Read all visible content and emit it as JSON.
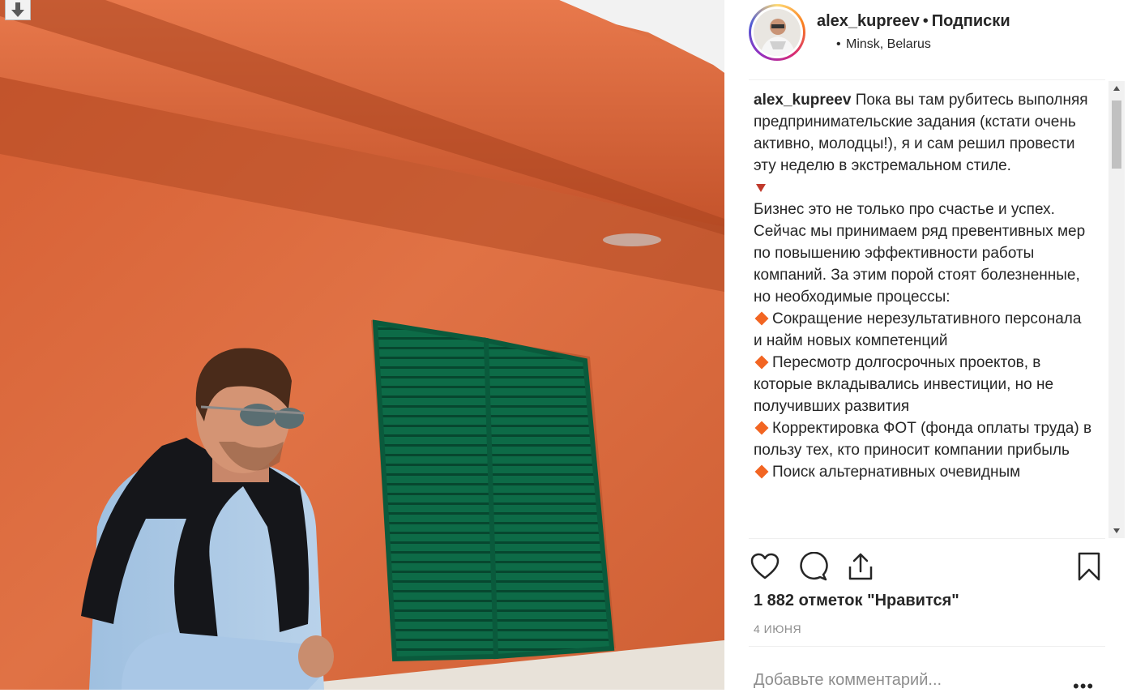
{
  "header": {
    "username": "alex_kupreev",
    "separator": "•",
    "follow_label": "Подписки",
    "location_dot": "•",
    "location": "Minsk, Belarus"
  },
  "caption": {
    "username": "alex_kupreev",
    "intro": "Пока вы там рубитесь выполняя предпринимательские задания (кстати очень активно, молодцы!), я и сам решил провести эту неделю в экстремальном стиле.",
    "body": "Бизнес это не только про счастье и успех. Сейчас мы принимаем ряд превентивных мер по повышению эффективности работы компаний. За этим порой стоят болезненные, но необходимые процессы:",
    "bullets": [
      "Сокращение нерезультативного персонала и найм новых компетенций",
      "Пересмотр долгосрочных проектов, в которые вкладывались инвестиции, но не получивших развития",
      "Корректировка ФОТ (фонда оплаты труда) в пользу тех, кто приносит компании прибыль",
      "Поиск альтернативных очевидным"
    ]
  },
  "actions": {
    "like_icon": "heart-icon",
    "comment_icon": "comment-icon",
    "share_icon": "share-icon",
    "save_icon": "bookmark-icon"
  },
  "likes_text": "1 882 отметок \"Нравится\"",
  "date": "4 ИЮНЯ",
  "comment": {
    "placeholder": "Добавьте комментарий...",
    "more": "•••"
  },
  "colors": {
    "wall": "#d9683e",
    "shutter": "#0f6e4a",
    "bullet": "#f26522",
    "muted": "#8e8e8e"
  }
}
